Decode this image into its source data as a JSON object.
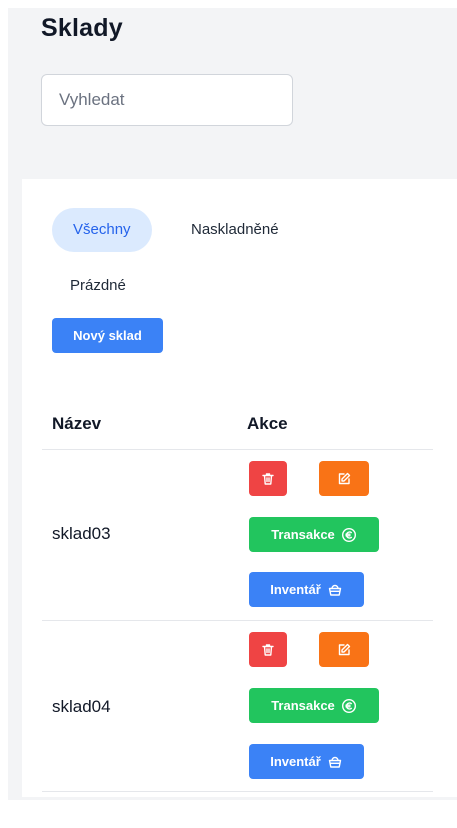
{
  "header": {
    "title": "Sklady"
  },
  "search": {
    "placeholder": "Vyhledat"
  },
  "tabs": [
    {
      "label": "Všechny",
      "active": true
    },
    {
      "label": "Naskladněné",
      "active": false
    },
    {
      "label": "Prázdné",
      "active": false
    }
  ],
  "actions": {
    "new_label": "Nový sklad"
  },
  "table": {
    "columns": [
      "Název",
      "Akce"
    ],
    "rows": [
      {
        "name": "sklad03",
        "transactions_label": "Transakce",
        "inventory_label": "Inventář"
      },
      {
        "name": "sklad04",
        "transactions_label": "Transakce",
        "inventory_label": "Inventář"
      }
    ]
  },
  "icons": {
    "delete": "trash-icon",
    "edit": "edit-icon",
    "transactions": "euro-circle-icon",
    "inventory": "basket-icon"
  },
  "colors": {
    "primary": "#3b82f6",
    "danger": "#ef4444",
    "warning": "#f97316",
    "success": "#22c55e",
    "tab_active_bg": "#dbeafe"
  }
}
